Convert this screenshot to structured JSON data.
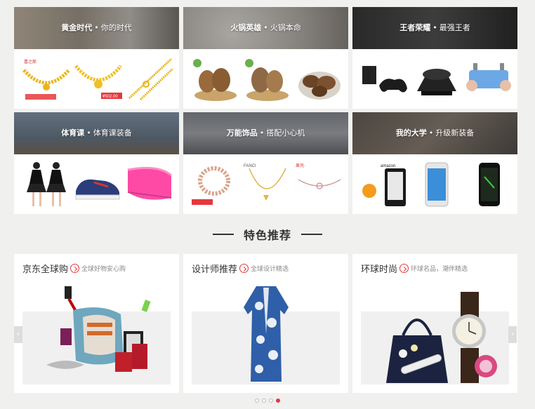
{
  "categories": [
    {
      "title": "黄金时代",
      "subtitle": "你的时代"
    },
    {
      "title": "火锅英雄",
      "subtitle": "火锅本命"
    },
    {
      "title": "王者荣耀",
      "subtitle": "最强王者"
    },
    {
      "title": "体育课",
      "subtitle": "体育课装备"
    },
    {
      "title": "万能饰品",
      "subtitle": "搭配小心机"
    },
    {
      "title": "我的大学",
      "subtitle": "升级新装备"
    }
  ],
  "separator": "•",
  "section_title": "特色推荐",
  "features": [
    {
      "title": "京东全球购",
      "subtitle": "全球好物安心购"
    },
    {
      "title": "设计师推荐",
      "subtitle": "全球设计精选"
    },
    {
      "title": "环球时尚",
      "subtitle": "环球名品，潮伴精选"
    }
  ],
  "product_labels": {
    "gold_brand": "喜之郎",
    "price_tag": "¥502.00",
    "amazon": "amazon",
    "fanci": "FANCI",
    "pink_brand": "果壳·"
  },
  "carousel": {
    "pages": 4,
    "active": 3
  },
  "colors": {
    "accent": "#e4393c",
    "gold": "#e8b51c"
  }
}
